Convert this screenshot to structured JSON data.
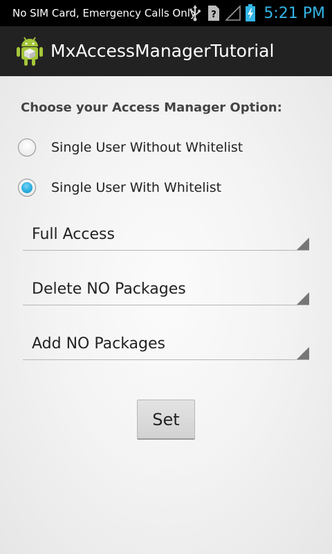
{
  "status_bar": {
    "carrier_text": "No SIM Card, Emergency Calls Only",
    "time": "5:21 PM",
    "icons": [
      "usb-icon",
      "no-sim-icon",
      "signal-icon",
      "battery-charging-icon"
    ]
  },
  "action_bar": {
    "icon": "android-icon",
    "title": "MxAccessManagerTutorial"
  },
  "main": {
    "prompt": "Choose your Access Manager Option:",
    "options": [
      {
        "label": "Single User Without Whitelist",
        "checked": false
      },
      {
        "label": "Single User With Whitelist",
        "checked": true
      }
    ],
    "spinners": [
      {
        "value": "Full Access"
      },
      {
        "value": "Delete NO Packages"
      },
      {
        "value": "Add NO Packages"
      }
    ],
    "set_button_label": "Set"
  },
  "colors": {
    "accent": "#33b5e5",
    "action_bar_bg": "#222222",
    "status_bar_bg": "#000000"
  }
}
